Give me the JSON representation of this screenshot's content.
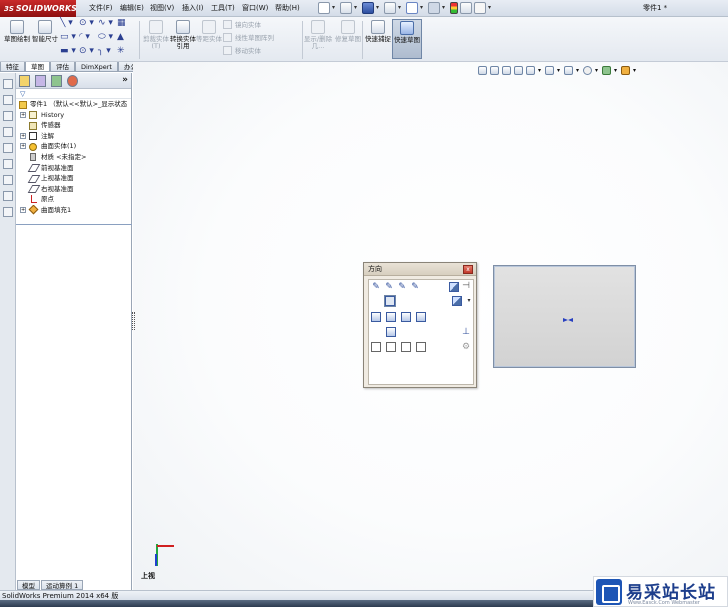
{
  "app": {
    "logo": "SOLIDWORKS",
    "logo_prefix": "3S",
    "document_title": "零件1 *"
  },
  "menu": [
    {
      "label": "文件(F)"
    },
    {
      "label": "编辑(E)"
    },
    {
      "label": "视图(V)"
    },
    {
      "label": "插入(I)"
    },
    {
      "label": "工具(T)"
    },
    {
      "label": "窗口(W)"
    },
    {
      "label": "帮助(H)"
    }
  ],
  "command_manager": {
    "sketch": "草图绘制",
    "smart_dimension": "智能尺寸",
    "trim": "剪裁实体(T)",
    "convert": "转换实体引用",
    "offset": "等距实体",
    "mirror": "镜向实体",
    "linear_pattern": "线性草图阵列",
    "move": "移动实体",
    "display_delete": "显示/删除几...",
    "repair": "修复草图",
    "rapid": "快速捕捉",
    "quick_sketch": "快速草图"
  },
  "tabs": [
    {
      "label": "特征",
      "active": false
    },
    {
      "label": "草图",
      "active": true
    },
    {
      "label": "评估",
      "active": false
    },
    {
      "label": "DimXpert",
      "active": false
    },
    {
      "label": "办公室产品",
      "active": false
    }
  ],
  "feature_tree": {
    "root": "零件1 （默认<<默认>_显示状态",
    "items": [
      {
        "label": "History",
        "icon": "history-icon"
      },
      {
        "label": "传感器",
        "icon": "sensor-icon"
      },
      {
        "label": "注解",
        "icon": "annotation-icon"
      },
      {
        "label": "曲面实体(1)",
        "icon": "surface-body-icon"
      },
      {
        "label": "材质 <未指定>",
        "icon": "material-icon"
      },
      {
        "label": "前视基准面",
        "icon": "plane-icon"
      },
      {
        "label": "上视基准面",
        "icon": "plane-icon"
      },
      {
        "label": "右视基准面",
        "icon": "plane-icon"
      },
      {
        "label": "原点",
        "icon": "origin-icon"
      },
      {
        "label": "曲面填充1",
        "icon": "surface-fill-icon"
      }
    ]
  },
  "bottom_tabs": [
    {
      "label": "模型"
    },
    {
      "label": "运动算例 1"
    }
  ],
  "orientation_dialog": {
    "title": "方向",
    "close": "x"
  },
  "view_label": "上视",
  "status_bar": "SolidWorks Premium 2014 x64 版",
  "watermark": {
    "text": "易采站长站",
    "sub": "Www.Easck.Com  Webmaster"
  },
  "colors": {
    "accent_red": "#c92a2a",
    "tree_divider": "#8aa0c0",
    "x_axis": "#d02020",
    "y_axis": "#22a640",
    "z_axis": "#2040d0"
  }
}
